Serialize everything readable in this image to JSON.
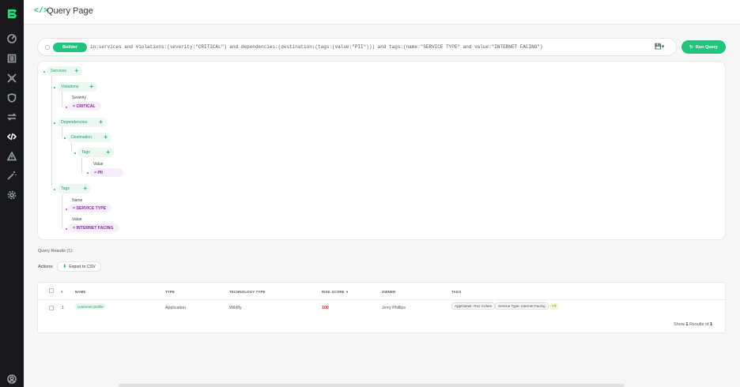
{
  "header": {
    "code_icon": "</>",
    "title": "Query Page"
  },
  "sidebar": {
    "items": [
      {
        "name": "dashboard-icon"
      },
      {
        "name": "inventory-icon"
      },
      {
        "name": "graph-icon"
      },
      {
        "name": "shield-icon"
      },
      {
        "name": "transfer-icon"
      },
      {
        "name": "code-icon",
        "active": true
      },
      {
        "name": "warning-icon"
      },
      {
        "name": "magic-wand-icon"
      },
      {
        "name": "gear-icon"
      },
      {
        "name": "user-icon"
      }
    ]
  },
  "query": {
    "mode_label": "Builder",
    "text": "in:services and violations:(severity:\"CRITICAL\") and dependencies:(destination:(tags:(value:\"PII\"))) and tags:(name:\"SERVICE TYPE\" and value:\"INTERNET FACING\")",
    "run_label": "Run Query"
  },
  "tree": {
    "services": "Services",
    "violations": "Violations",
    "severity_field": "Severity",
    "severity_value": "= CRITICAL",
    "dependencies": "Dependencies",
    "destination": "Destination",
    "dest_tags": "Tags",
    "dest_value_field": "Value",
    "dest_value": "= PII",
    "tags": "Tags",
    "name_field": "Name",
    "name_value": "= SERVICE TYPE",
    "value_field": "Value",
    "value_value": "= INTERNET FACING"
  },
  "results": {
    "count_label": "Query Results (1):",
    "actions_label": "Actions:",
    "export_label": "Export to CSV",
    "columns": [
      "#",
      "NAME",
      "TYPE",
      "TECHNOLOGY TYPE",
      "RISK SCORE",
      "OWNER",
      "TAGS"
    ],
    "rows": [
      {
        "index": "1",
        "name": "customer-profile",
        "type": "Application",
        "tech": "Wildfly",
        "risk": "100",
        "owner": "Jerry Phillips",
        "tags": [
          "AppOwner: Roz Cohen",
          "Service Type: Internet Facing"
        ],
        "more": "+4"
      }
    ],
    "footer_prefix": "Show",
    "footer_shown": "1",
    "footer_mid": "Results of",
    "footer_total": "1"
  },
  "colors": {
    "accent": "#22c37a",
    "sidebar": "#16181c",
    "value_purple": "#8a2aa8",
    "risk_red": "#d0282a"
  }
}
